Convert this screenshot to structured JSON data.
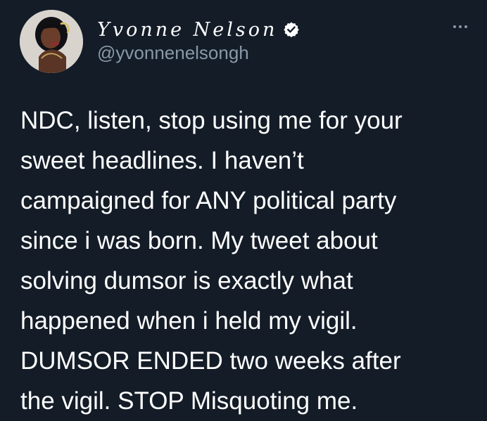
{
  "tweet": {
    "author": {
      "display_name": "Yvonne Nelson",
      "handle": "@yvonnenelsongh",
      "verified": true,
      "avatar_icon": "profile-photo-icon"
    },
    "menu_icon": "more-options-icon",
    "text": "NDC, listen, stop using me for your\nsweet headlines. I haven’t\ncampaigned for ANY political party\nsince i was born. My tweet about\nsolving dumsor is exactly what\nhappened when i held my vigil.\nDUMSOR ENDED two weeks after\nthe vigil. STOP Misquoting me.",
    "colors": {
      "background": "#131c27",
      "text": "#ffffff",
      "secondary_text": "#8899a6",
      "verified_badge": "#ffffff"
    }
  }
}
